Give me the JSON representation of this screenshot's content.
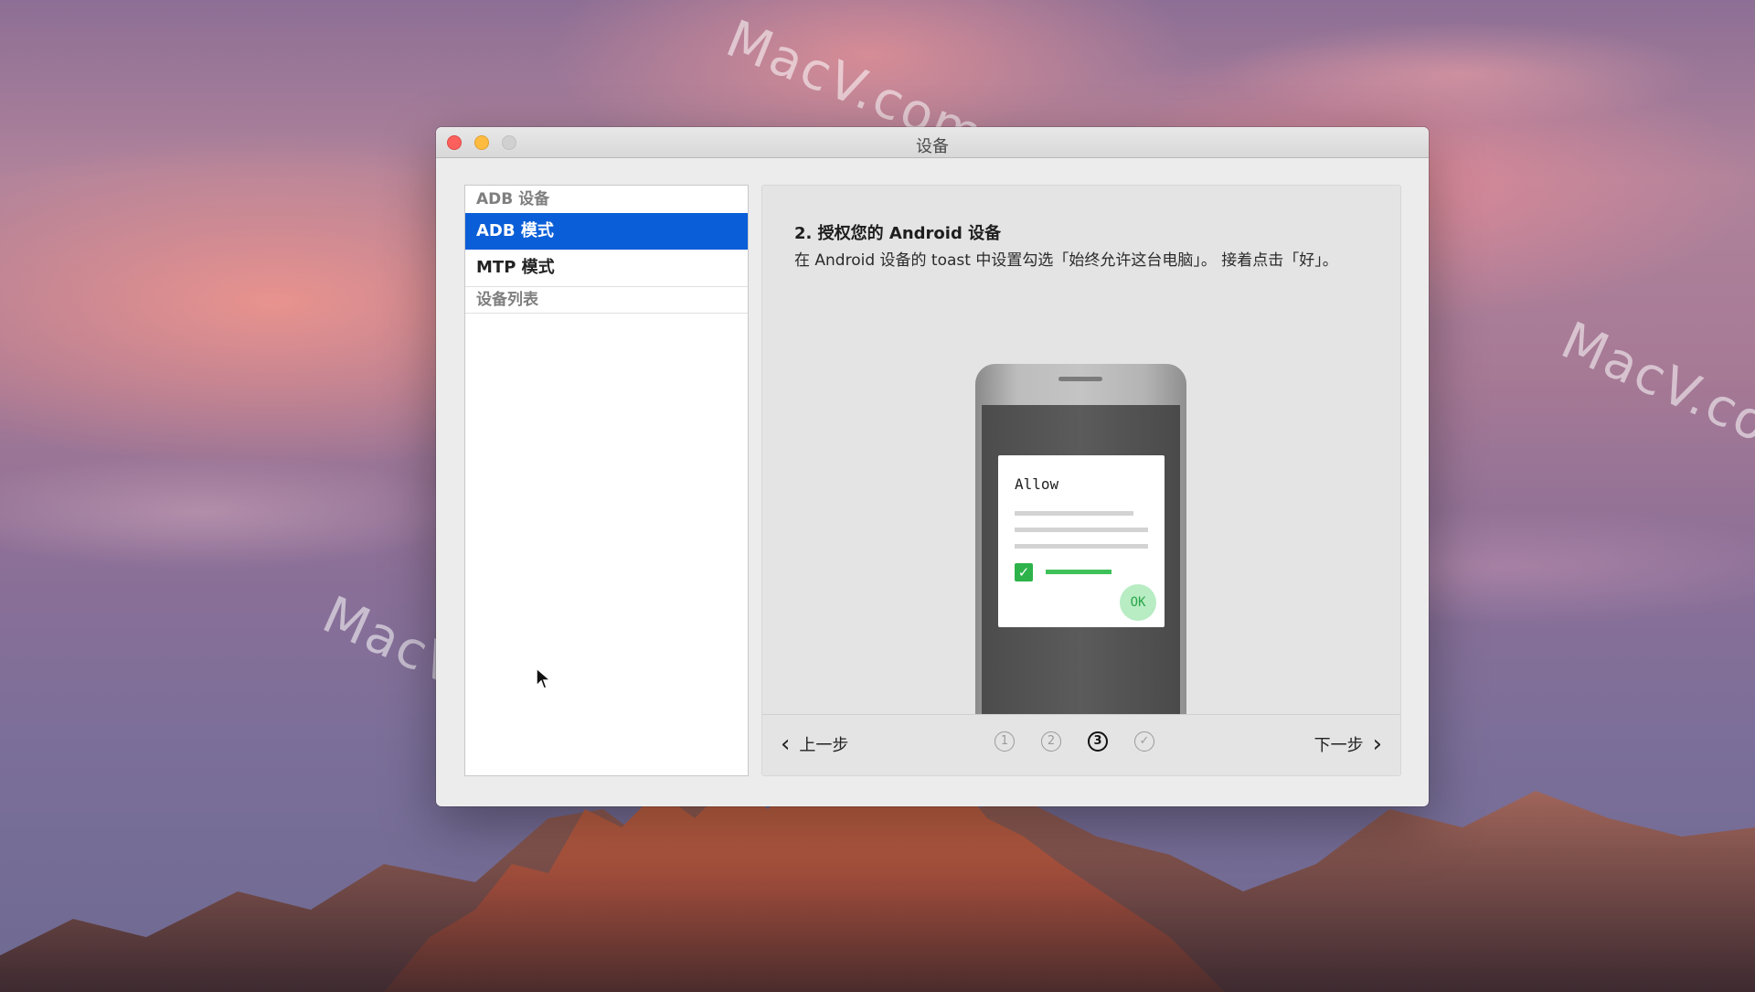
{
  "desktop": {
    "watermarks": [
      "MacV.com",
      "MacV.co",
      "MacV.com"
    ]
  },
  "window": {
    "title": "设备",
    "controls": [
      "close",
      "minimize",
      "zoom"
    ]
  },
  "sidebar": {
    "section_adb": "ADB 设备",
    "items": [
      {
        "label": "ADB 模式",
        "selected": true
      },
      {
        "label": "MTP 模式",
        "selected": false
      }
    ],
    "section_devices": "设备列表"
  },
  "panel": {
    "step_title": "2. 授权您的 Android 设备",
    "step_desc": "在 Android 设备的 toast 中设置勾选「始终允许这台电脑」。 接着点击「好」。",
    "illustration": {
      "dialog_title": "Allow",
      "ok_label": "OK",
      "check_icon": "checkbox-checked-icon"
    },
    "footer": {
      "prev_label": "上一步",
      "next_label": "下一步",
      "steps": [
        "1",
        "2",
        "3",
        "✓"
      ],
      "current_step_index": 2
    }
  },
  "colors": {
    "selection": "#0a5ed8",
    "check_green": "#2db34a",
    "ok_bg": "#b8ecc3"
  }
}
